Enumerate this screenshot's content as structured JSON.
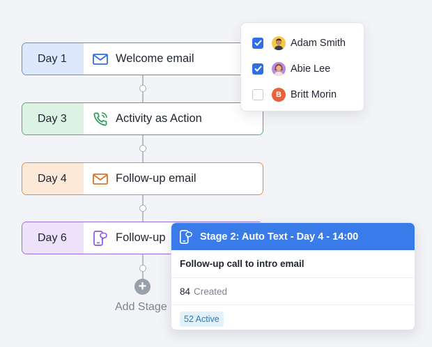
{
  "stages": [
    {
      "day": "Day 1",
      "label": "Welcome email",
      "icon": "email-icon",
      "color": "#5b8def"
    },
    {
      "day": "Day 3",
      "label": "Activity as Action",
      "icon": "phone-call-icon",
      "color": "#43b36b"
    },
    {
      "day": "Day 4",
      "label": "Follow-up email",
      "icon": "email-icon",
      "color": "#e8883a"
    },
    {
      "day": "Day 6",
      "label": "Follow-up",
      "icon": "phone-chat-icon",
      "color": "#9a6de0"
    }
  ],
  "add_stage": {
    "label": "Add Stage",
    "icon": "plus-icon"
  },
  "assignees": [
    {
      "name": "Adam Smith",
      "checked": true
    },
    {
      "name": "Abie Lee",
      "checked": true
    },
    {
      "name": "Britt Morin",
      "checked": false,
      "initial": "B"
    }
  ],
  "detail": {
    "title": "Stage 2: Auto Text - Day 4 - 14:00",
    "description": "Follow-up call to intro email",
    "created_count": "84",
    "created_label": "Created",
    "active_label": "52 Active",
    "accent": "#3a7bea"
  }
}
